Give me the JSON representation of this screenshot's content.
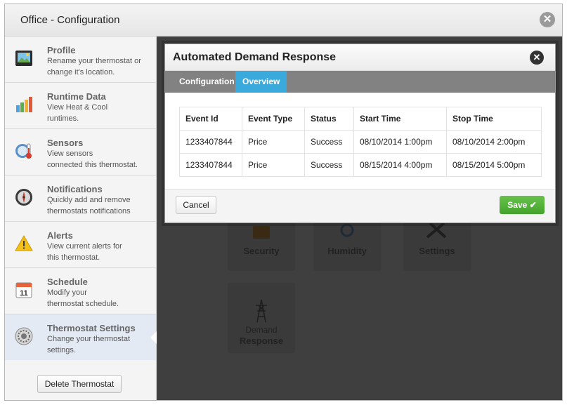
{
  "window": {
    "title": "Office - Configuration"
  },
  "sidebar": {
    "items": [
      {
        "icon": "profile-picture-icon",
        "title": "Profile",
        "desc1": "Rename your thermostat or",
        "desc2": "change it's location."
      },
      {
        "icon": "bar-chart-icon",
        "title": "Runtime Data",
        "desc1": "View Heat & Cool",
        "desc2": "runtimes."
      },
      {
        "icon": "thermometer-icon",
        "title": "Sensors",
        "desc1": "View sensors",
        "desc2": "connected this thermostat."
      },
      {
        "icon": "compass-icon",
        "title": "Notifications",
        "desc1": "Quickly add and remove",
        "desc2": "thermostats notifications"
      },
      {
        "icon": "warning-icon",
        "title": "Alerts",
        "desc1": "View current alerts for",
        "desc2": "this thermostat."
      },
      {
        "icon": "calendar-icon",
        "title": "Schedule",
        "desc1": "Modify your",
        "desc2": "thermostat schedule.",
        "calendar_day": "11"
      },
      {
        "icon": "thermostat-dial-icon",
        "title": "Thermostat Settings",
        "desc1": "Change your thermostat",
        "desc2": "settings."
      }
    ],
    "delete_label": "Delete Thermostat"
  },
  "tiles": {
    "security": "Security",
    "humidity": "Humidity",
    "settings": "Settings",
    "demand_line1": "Demand",
    "demand_line2": "Response"
  },
  "modal": {
    "title": "Automated Demand Response",
    "tabs": [
      "Configuration",
      "Overview"
    ],
    "active_tab": "Overview",
    "columns": [
      "Event Id",
      "Event Type",
      "Status",
      "Start Time",
      "Stop Time"
    ],
    "rows": [
      [
        "1233407844",
        "Price",
        "Success",
        "08/10/2014 1:00pm",
        "08/10/2014 2:00pm"
      ],
      [
        "1233407844",
        "Price",
        "Success",
        "08/15/2014 4:00pm",
        "08/15/2014 5:00pm"
      ]
    ],
    "cancel_label": "Cancel",
    "save_label": "Save ✔"
  },
  "colors": {
    "tab_active": "#3aa9dc",
    "save_green": "#4caf33",
    "overlay": "#3f3f3f"
  }
}
